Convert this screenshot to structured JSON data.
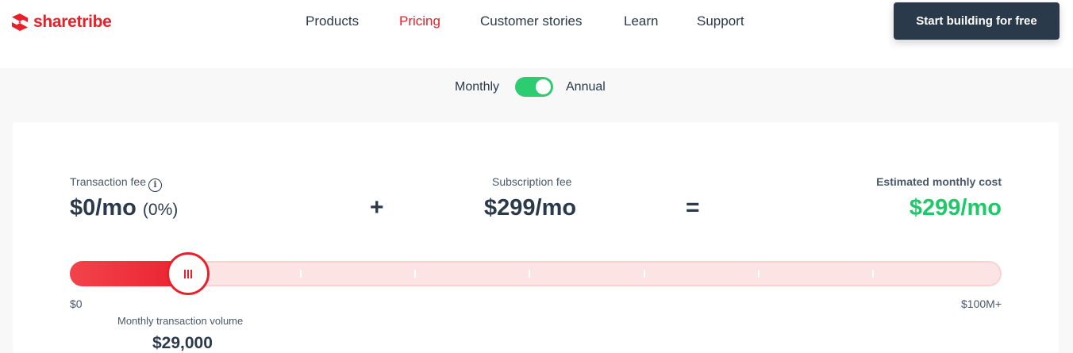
{
  "brand": {
    "name": "sharetribe",
    "color": "#e8202a"
  },
  "nav": {
    "items": [
      {
        "label": "Products",
        "active": false
      },
      {
        "label": "Pricing",
        "active": true
      },
      {
        "label": "Customer stories",
        "active": false
      },
      {
        "label": "Learn",
        "active": false
      },
      {
        "label": "Support",
        "active": false
      }
    ],
    "cta_label": "Start building for free"
  },
  "billing_toggle": {
    "left_label": "Monthly",
    "right_label": "Annual",
    "selected": "Annual",
    "on_color": "#2ecc71"
  },
  "calculator": {
    "transaction_fee": {
      "label": "Transaction fee",
      "value": "$0/mo",
      "percent": "(0%)",
      "icon": "info-icon"
    },
    "plus_symbol": "+",
    "subscription_fee": {
      "label": "Subscription fee",
      "value": "$299/mo"
    },
    "equals_symbol": "=",
    "estimated_cost": {
      "label": "Estimated monthly cost",
      "value": "$299/mo",
      "color": "#1fc96a"
    },
    "slider": {
      "min_label": "$0",
      "max_label": "$100M+",
      "position_fraction": 0.127,
      "steps": 8,
      "volume_label": "Monthly transaction volume",
      "volume_value": "$29,000",
      "fill_color": "#ea2230",
      "track_color": "#fde4e4"
    }
  }
}
